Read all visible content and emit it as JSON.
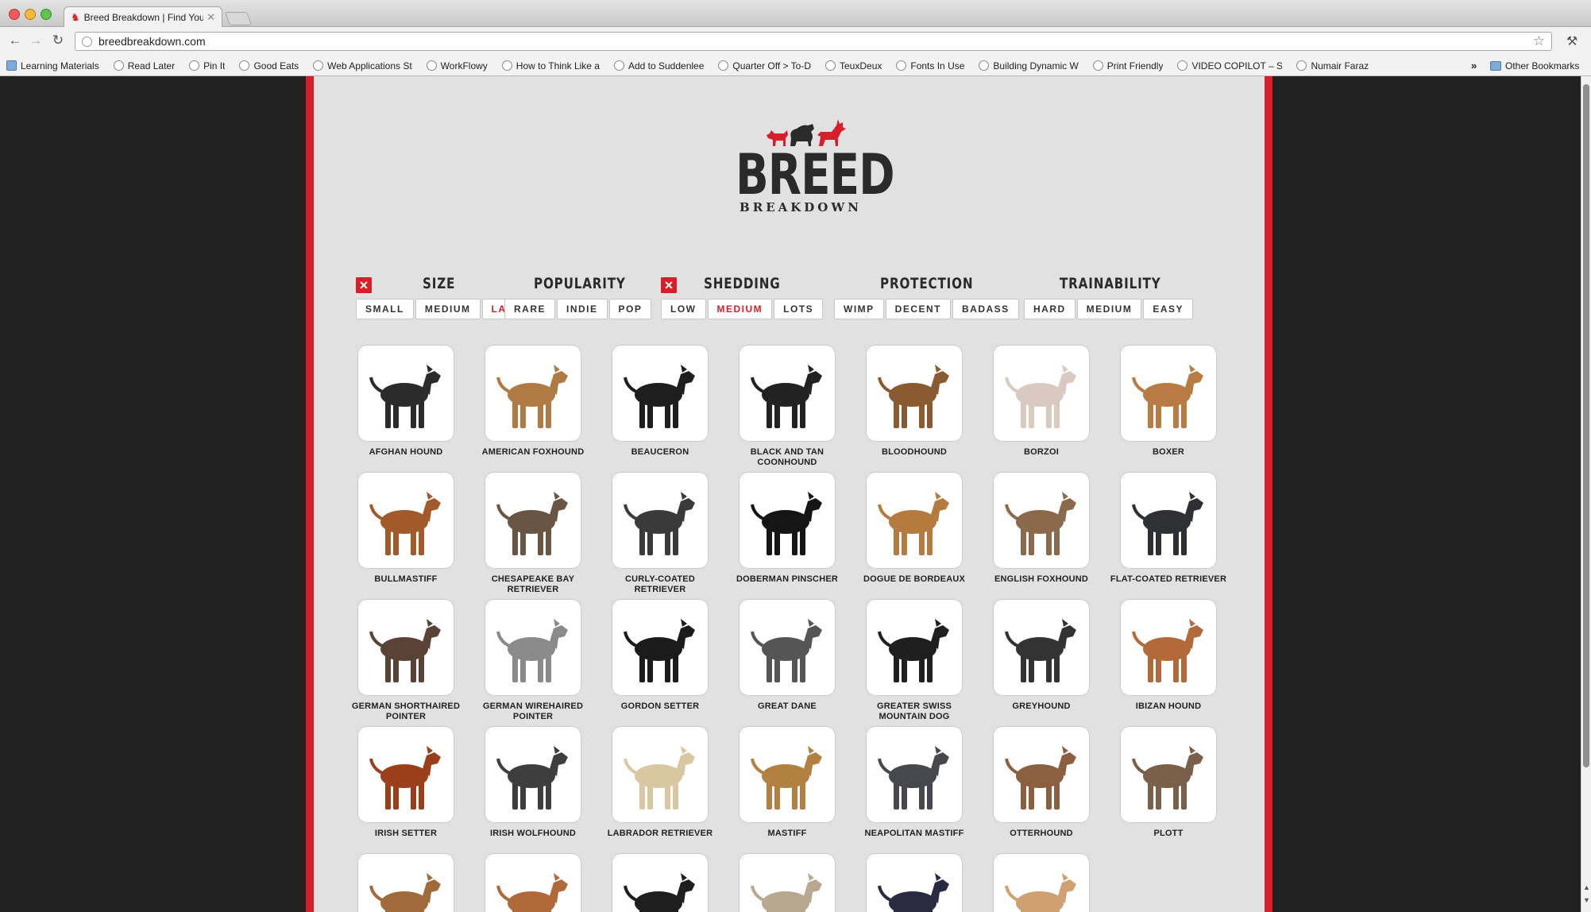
{
  "browser": {
    "tab_title": "Breed Breakdown | Find Your",
    "url": "breedbreakdown.com",
    "bookmarks": [
      {
        "label": "Learning Materials",
        "icon": "folder-icon"
      },
      {
        "label": "Read Later",
        "icon": "globe-icon"
      },
      {
        "label": "Pin It",
        "icon": "globe-icon"
      },
      {
        "label": "Good Eats",
        "icon": "globe-icon"
      },
      {
        "label": "Web Applications St",
        "icon": "globe-icon"
      },
      {
        "label": "WorkFlowy",
        "icon": "workflowy-icon"
      },
      {
        "label": "How to Think Like a",
        "icon": "globe-icon"
      },
      {
        "label": "Add to Suddenlee",
        "icon": "globe-icon"
      },
      {
        "label": "Quarter Off > To-D",
        "icon": "cloud-icon"
      },
      {
        "label": "TeuxDeux",
        "icon": "chevron-icon"
      },
      {
        "label": "Fonts In Use",
        "icon": "grid-icon"
      },
      {
        "label": "Building Dynamic W",
        "icon": "shield-icon"
      },
      {
        "label": "Print Friendly",
        "icon": "globe-icon"
      },
      {
        "label": "VIDEO COPILOT – Sc",
        "icon": "v-icon"
      },
      {
        "label": "Numair Faraz",
        "icon": "person-icon"
      }
    ],
    "more_label": "»",
    "other_bookmarks": "Other Bookmarks"
  },
  "logo": {
    "main": "BREED",
    "sub": "BREAKDOWN"
  },
  "colors": {
    "accent": "#d81e2a",
    "panel": "#e1e1e1",
    "dark": "#222222"
  },
  "filters": {
    "size": {
      "title": "SIZE",
      "clear": "✕",
      "options": [
        "SMALL",
        "MEDIUM",
        "LARGE"
      ],
      "active": "LARGE"
    },
    "popularity": {
      "title": "POPULARITY",
      "options": [
        "RARE",
        "INDIE",
        "POP"
      ]
    },
    "shedding": {
      "title": "SHEDDING",
      "clear": "✕",
      "options": [
        "LOW",
        "MEDIUM",
        "LOTS"
      ],
      "active": "MEDIUM"
    },
    "protection": {
      "title": "PROTECTION",
      "options": [
        "WIMP",
        "DECENT",
        "BADASS"
      ]
    },
    "trainability": {
      "title": "TRAINABILITY",
      "options": [
        "HARD",
        "MEDIUM",
        "EASY"
      ]
    }
  },
  "breeds": [
    {
      "name": "AFGHAN HOUND",
      "color": "#2b2b2b"
    },
    {
      "name": "AMERICAN FOXHOUND",
      "color": "#b07a45"
    },
    {
      "name": "BEAUCERON",
      "color": "#1e1e1e"
    },
    {
      "name": "BLACK AND TAN COONHOUND",
      "color": "#222222"
    },
    {
      "name": "BLOODHOUND",
      "color": "#8a5a30"
    },
    {
      "name": "BORZOI",
      "color": "#d9c9c0"
    },
    {
      "name": "BOXER",
      "color": "#b97b44"
    },
    {
      "name": "BULLMASTIFF",
      "color": "#a25a2a"
    },
    {
      "name": "CHESAPEAKE BAY RETRIEVER",
      "color": "#6a5443"
    },
    {
      "name": "CURLY-COATED RETRIEVER",
      "color": "#3a3a3a"
    },
    {
      "name": "DOBERMAN PINSCHER",
      "color": "#151515"
    },
    {
      "name": "DOGUE DE BORDEAUX",
      "color": "#b57a3e"
    },
    {
      "name": "ENGLISH FOXHOUND",
      "color": "#8a6a4a"
    },
    {
      "name": "FLAT-COATED RETRIEVER",
      "color": "#2e3033"
    },
    {
      "name": "GERMAN SHORTHAIRED POINTER",
      "color": "#5a4236"
    },
    {
      "name": "GERMAN WIREHAIRED POINTER",
      "color": "#8a8a8a"
    },
    {
      "name": "GORDON SETTER",
      "color": "#1b1b1b"
    },
    {
      "name": "GREAT DANE",
      "color": "#555555"
    },
    {
      "name": "GREATER SWISS MOUNTAIN DOG",
      "color": "#1f1f1f"
    },
    {
      "name": "GREYHOUND",
      "color": "#333333"
    },
    {
      "name": "IBIZAN HOUND",
      "color": "#b26a3a"
    },
    {
      "name": "IRISH SETTER",
      "color": "#9a3f1a"
    },
    {
      "name": "IRISH WOLFHOUND",
      "color": "#3e3e3e"
    },
    {
      "name": "LABRADOR RETRIEVER",
      "color": "#d8c7a0"
    },
    {
      "name": "MASTIFF",
      "color": "#b28040"
    },
    {
      "name": "NEAPOLITAN MASTIFF",
      "color": "#47484d"
    },
    {
      "name": "OTTERHOUND",
      "color": "#8a6040"
    },
    {
      "name": "PLOTT",
      "color": "#7a6048"
    },
    {
      "name": "",
      "color": "#a06a3a"
    },
    {
      "name": "",
      "color": "#b06a3a"
    },
    {
      "name": "",
      "color": "#1e1e1e"
    },
    {
      "name": "",
      "color": "#b8a890"
    },
    {
      "name": "",
      "color": "#2a2a40"
    },
    {
      "name": "",
      "color": "#d0a070"
    }
  ]
}
